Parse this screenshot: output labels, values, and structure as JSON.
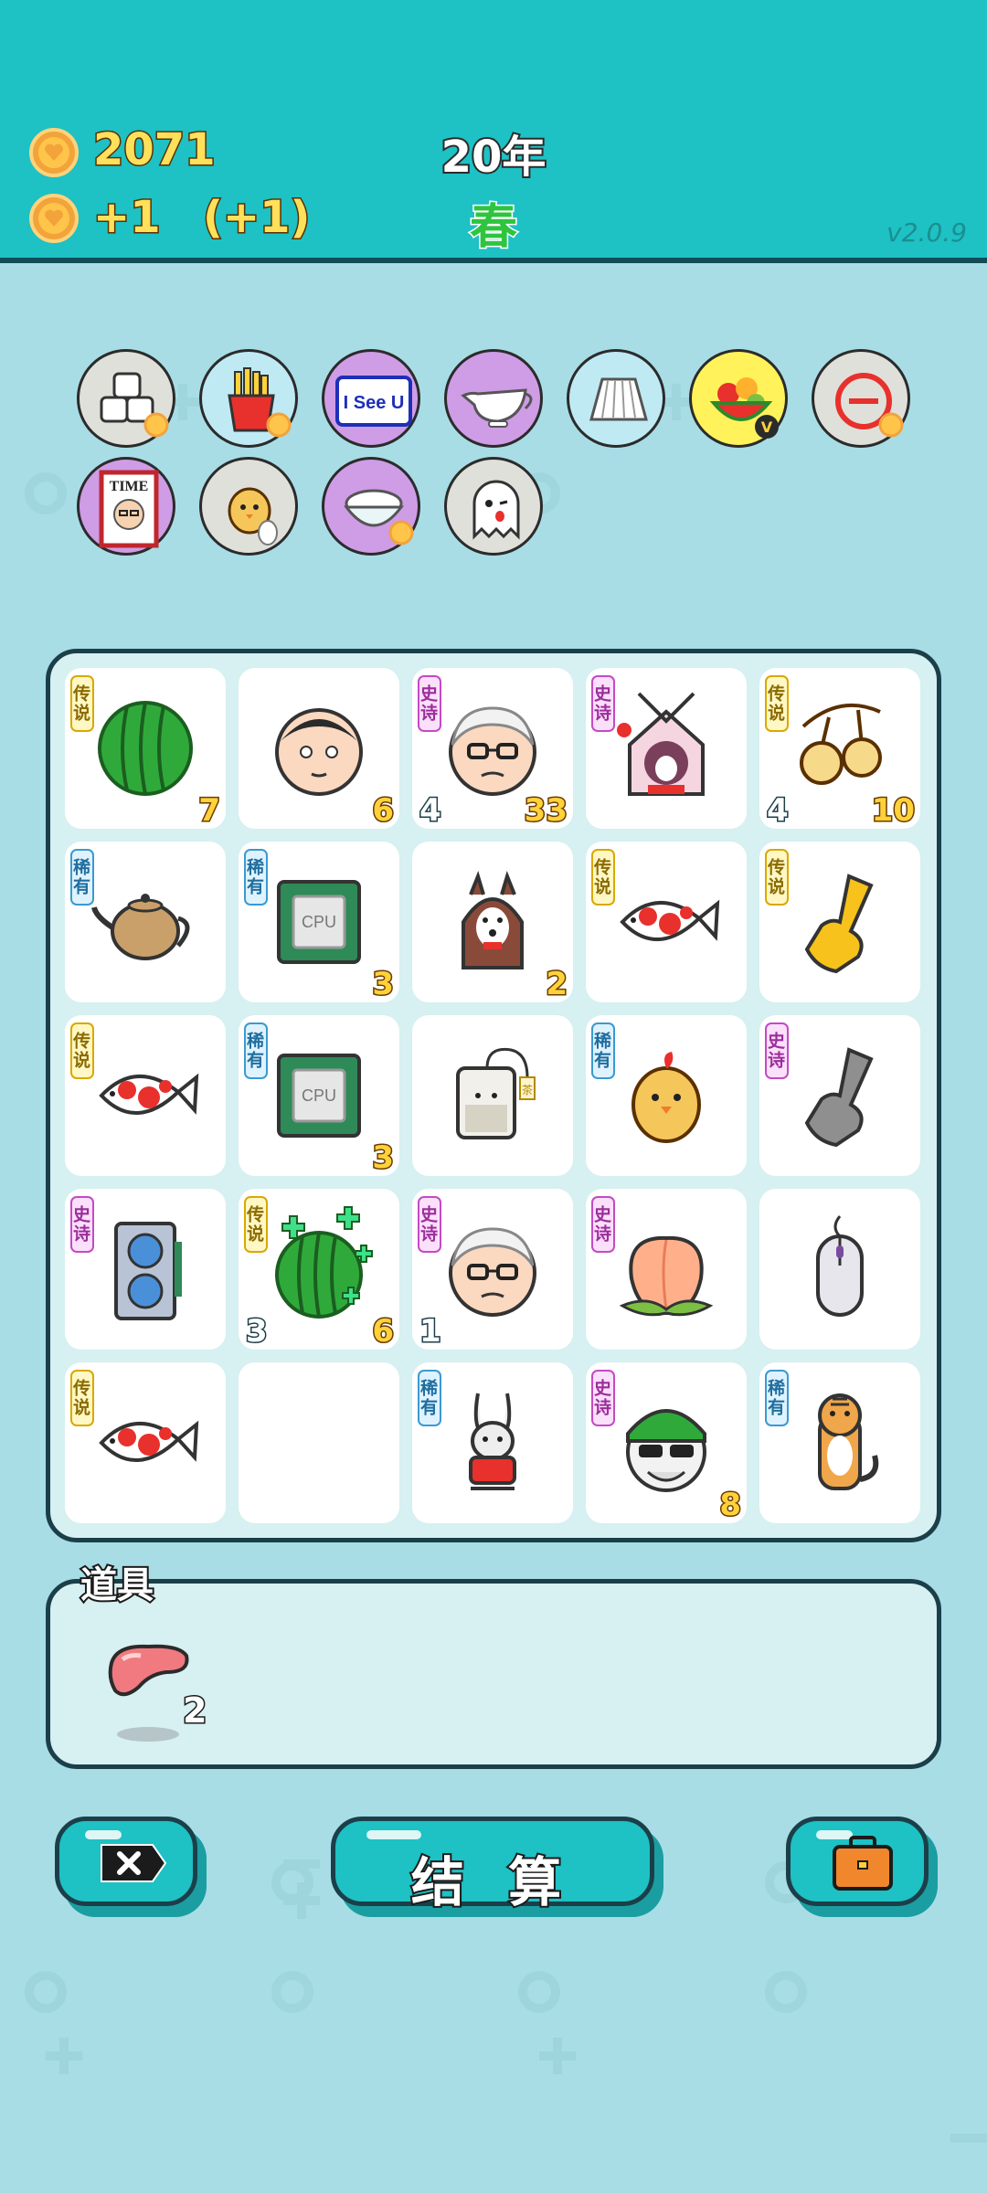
{
  "header": {
    "coins": "2071",
    "income": "+1",
    "income_bonus": "(+1)",
    "year": "20年",
    "season": "春",
    "version": "v2.0.9"
  },
  "owned_badges": [
    {
      "icon": "sugar-cubes-icon",
      "bg": "#dfe0da"
    },
    {
      "icon": "french-fries-icon",
      "bg": "#bfeaf4"
    },
    {
      "icon": "i-see-u-sign-icon",
      "bg": "#cf9ce6"
    },
    {
      "icon": "gravy-boat-icon",
      "bg": "#cf9ce6"
    },
    {
      "icon": "pleated-skirt-icon",
      "bg": "#bfeaf4"
    },
    {
      "icon": "fruit-basket-icon",
      "bg": "#fff25a"
    },
    {
      "icon": "minus-circle-icon",
      "bg": "#dfe0da"
    },
    {
      "icon": "time-magazine-icon",
      "bg": "#cf9ce6"
    },
    {
      "icon": "chick-egg-icon",
      "bg": "#dfe0da"
    },
    {
      "icon": "rice-bowl-icon",
      "bg": "#cf9ce6"
    },
    {
      "icon": "ghost-icon",
      "bg": "#dfe0da"
    }
  ],
  "time_badge_text": "TIME",
  "i_see_u_text": "I See U",
  "fruit_badge_letter": "V",
  "cpu_text": "CPU",
  "tea_tag_text": "茶",
  "board": [
    [
      {
        "icon": "watermelon-icon",
        "tag": "传说",
        "rarity": "legend",
        "num_right": "7",
        "num_left": ""
      },
      {
        "icon": "bald-man-face-icon",
        "tag": "",
        "rarity": "",
        "num_right": "6",
        "num_left": ""
      },
      {
        "icon": "old-man-glasses-icon",
        "tag": "史诗",
        "rarity": "epic",
        "num_right": "33",
        "num_left": "4"
      },
      {
        "icon": "rabbit-lantern-house-icon",
        "tag": "史诗",
        "rarity": "epic",
        "num_right": "",
        "num_left": ""
      },
      {
        "icon": "golden-cherries-icon",
        "tag": "传说",
        "rarity": "legend",
        "num_right": "10",
        "num_left": "4"
      }
    ],
    [
      {
        "icon": "teapot-icon",
        "tag": "稀有",
        "rarity": "rare",
        "num_right": "",
        "num_left": ""
      },
      {
        "icon": "cpu-chip-icon",
        "tag": "稀有",
        "rarity": "rare",
        "num_right": "3",
        "num_left": ""
      },
      {
        "icon": "husky-dog-icon",
        "tag": "",
        "rarity": "",
        "num_right": "2",
        "num_left": ""
      },
      {
        "icon": "koi-fish-icon",
        "tag": "传说",
        "rarity": "legend",
        "num_right": "",
        "num_left": ""
      },
      {
        "icon": "golden-hand-icon",
        "tag": "传说",
        "rarity": "legend",
        "num_right": "",
        "num_left": ""
      }
    ],
    [
      {
        "icon": "koi-fish-icon",
        "tag": "传说",
        "rarity": "legend",
        "num_right": "",
        "num_left": ""
      },
      {
        "icon": "cpu-chip-icon",
        "tag": "稀有",
        "rarity": "rare",
        "num_right": "3",
        "num_left": ""
      },
      {
        "icon": "tea-bag-icon",
        "tag": "",
        "rarity": "",
        "num_right": "",
        "num_left": ""
      },
      {
        "icon": "chick-icon",
        "tag": "稀有",
        "rarity": "rare",
        "num_right": "",
        "num_left": ""
      },
      {
        "icon": "gray-hand-icon",
        "tag": "史诗",
        "rarity": "epic",
        "num_right": "",
        "num_left": ""
      }
    ],
    [
      {
        "icon": "graphics-card-icon",
        "tag": "史诗",
        "rarity": "epic",
        "num_right": "",
        "num_left": ""
      },
      {
        "icon": "sparkling-watermelon-icon",
        "tag": "传说",
        "rarity": "legend",
        "num_right": "6",
        "num_left": "3"
      },
      {
        "icon": "old-man-glasses-icon",
        "tag": "史诗",
        "rarity": "epic",
        "num_right": "",
        "num_left": "1"
      },
      {
        "icon": "peach-icon",
        "tag": "史诗",
        "rarity": "epic",
        "num_right": "",
        "num_left": ""
      },
      {
        "icon": "computer-mouse-icon",
        "tag": "",
        "rarity": "",
        "num_right": "",
        "num_left": ""
      }
    ],
    [
      {
        "icon": "koi-fish-icon",
        "tag": "传说",
        "rarity": "legend",
        "num_right": "",
        "num_left": ""
      },
      {
        "icon": "",
        "tag": "",
        "rarity": "",
        "num_right": "",
        "num_left": ""
      },
      {
        "icon": "rabbit-red-shirt-icon",
        "tag": "稀有",
        "rarity": "rare",
        "num_right": "",
        "num_left": ""
      },
      {
        "icon": "green-hat-sunglasses-man-icon",
        "tag": "史诗",
        "rarity": "epic",
        "num_right": "8",
        "num_left": ""
      },
      {
        "icon": "tiger-icon",
        "tag": "稀有",
        "rarity": "rare",
        "num_right": "",
        "num_left": ""
      }
    ]
  ],
  "items_panel": {
    "title": "道具",
    "items": [
      {
        "icon": "liver-icon",
        "count": "2"
      }
    ]
  },
  "buttons": {
    "settle_label": "结 算"
  },
  "colors": {
    "header_bg": "#1ec1c4",
    "page_bg": "#a8dde6",
    "coin_text": "#ffe05a",
    "season_green": "#2fc43e"
  }
}
